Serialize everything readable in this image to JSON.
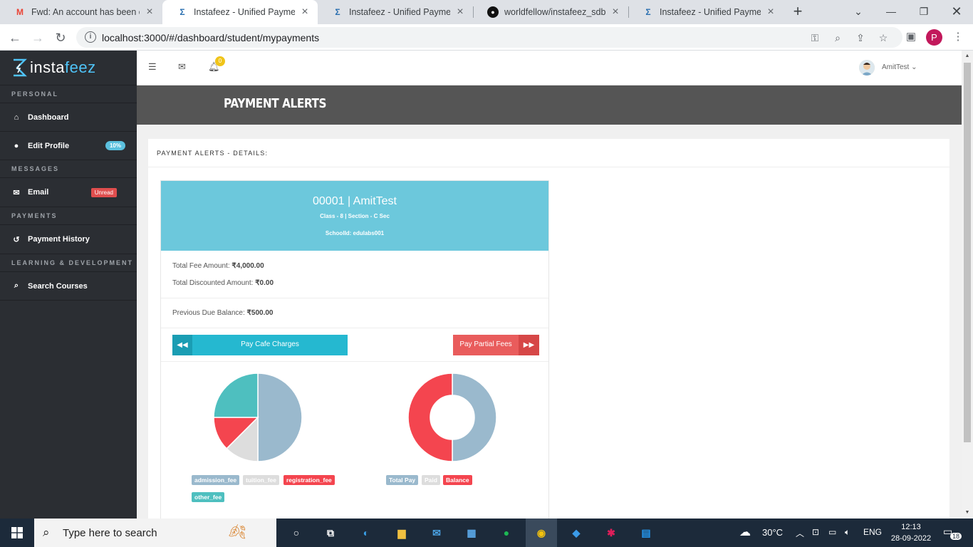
{
  "browser": {
    "tabs": [
      {
        "title": "Fwd: An account has been cr",
        "favicon": "gmail-icon",
        "active": false
      },
      {
        "title": "Instafeez - Unified Payments",
        "favicon": "instafeez-icon",
        "active": true
      },
      {
        "title": "Instafeez - Unified Payments",
        "favicon": "instafeez-icon",
        "active": false
      },
      {
        "title": "worldfellow/instafeez_sdbi",
        "favicon": "github-icon",
        "active": false
      },
      {
        "title": "Instafeez - Unified Payments",
        "favicon": "instafeez-icon",
        "active": false
      }
    ],
    "url": "localhost:3000/#/dashboard/student/mypayments",
    "profile_initial": "P"
  },
  "app": {
    "logo_left": "instafeez",
    "logo_a": "insta",
    "logo_b": "feez",
    "notification_count": "0",
    "user_name": "AmitTest",
    "page_title": "PAYMENT ALERTS"
  },
  "sidebar": {
    "sections": [
      {
        "label": "PERSONAL"
      },
      {
        "label": "MESSAGES"
      },
      {
        "label": "PAYMENTS"
      },
      {
        "label": "LEARNING & DEVELOPMENT"
      }
    ],
    "items": [
      {
        "label": "Dashboard",
        "icon": "home-icon"
      },
      {
        "label": "Edit Profile",
        "icon": "user-icon",
        "badge": "10%"
      },
      {
        "label": "Email",
        "icon": "envelope-icon",
        "badge": "Unread"
      },
      {
        "label": "Payment History",
        "icon": "history-icon"
      },
      {
        "label": "Search Courses",
        "icon": "search-icon"
      }
    ]
  },
  "panel": {
    "heading": "PAYMENT ALERTS - DETAILS:",
    "student": {
      "name": "00001 | AmitTest",
      "class": "Class - 8 | Section - C Sec",
      "school": "SchoolId: edulabs001"
    },
    "total_fee_label": "Total Fee Amount:",
    "total_fee_value": "₹4,000.00",
    "discount_label": "Total Discounted Amount:",
    "discount_value": "₹0.00",
    "prev_due_label": "Previous Due Balance:",
    "prev_due_value": "₹500.00",
    "btn_cafe": "Pay Cafe Charges",
    "btn_partial": "Pay Partial Fees"
  },
  "chart_data": [
    {
      "type": "pie",
      "categories": [
        "admission_fee",
        "tuition_fee",
        "registration_fee",
        "other_fee"
      ],
      "values": [
        50,
        12.5,
        12.5,
        25
      ],
      "colors": [
        "#9ab9cd",
        "#dddddd",
        "#f4454f",
        "#4ebfbf"
      ],
      "legend": "bottom"
    },
    {
      "type": "pie",
      "subtype": "doughnut",
      "categories": [
        "Total Pay",
        "Paid",
        "Balance"
      ],
      "values": [
        50,
        0,
        50
      ],
      "colors": [
        "#9ab9cd",
        "#dddddd",
        "#f4454f"
      ],
      "legend": "bottom"
    }
  ],
  "taskbar": {
    "search_placeholder": "Type here to search",
    "weather": "30°C",
    "language": "ENG",
    "time": "12:13",
    "date": "28-09-2022",
    "notifications": "18"
  }
}
